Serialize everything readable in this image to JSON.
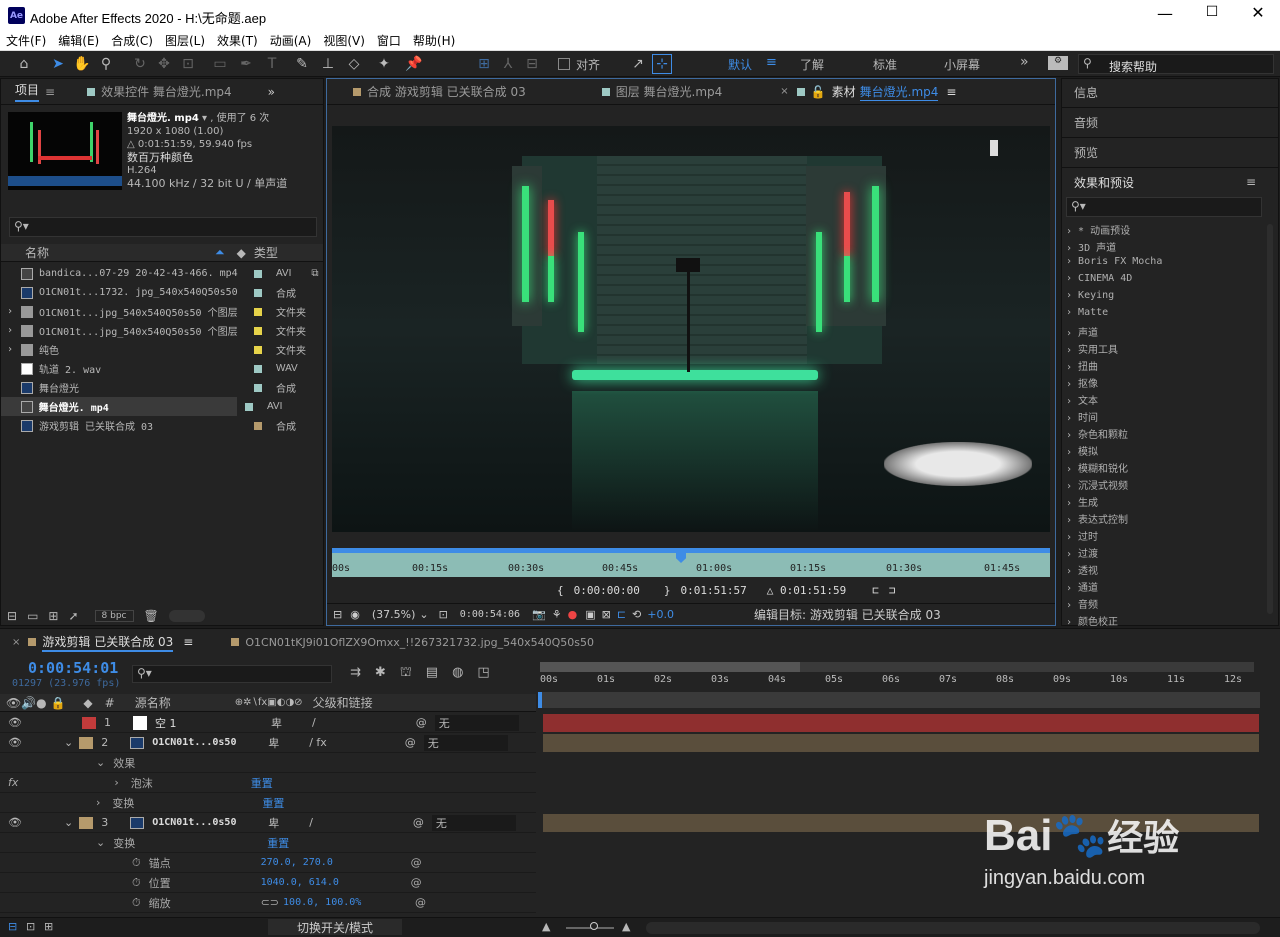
{
  "window": {
    "title": "Adobe After Effects 2020 - H:\\无命题.aep",
    "app_icon": "Ae"
  },
  "menu": [
    "文件(F)",
    "编辑(E)",
    "合成(C)",
    "图层(L)",
    "效果(T)",
    "动画(A)",
    "视图(V)",
    "窗口",
    "帮助(H)"
  ],
  "toolbar": {
    "snap_label": "对齐",
    "workspaces": [
      "默认",
      "了解",
      "标准",
      "小屏幕"
    ],
    "search_placeholder": "搜索帮助"
  },
  "project": {
    "tab_project": "项目",
    "tab_effects": "效果控件 舞台燈光.mp4",
    "asset_name": "舞台燈光. mp4",
    "asset_used": ", 使用了 6 次",
    "asset_res": "1920 x 1080 (1.00)",
    "asset_duration": "△ 0:01:51:59, 59.940 fps",
    "asset_colors": "数百万种颜色",
    "asset_codec": "H.264",
    "asset_audio": "44.100 kHz / 32 bit U / 单声道",
    "col_name": "名称",
    "col_type": "类型",
    "bpc": "8 bpc",
    "items": [
      {
        "name": "bandica...07-29 20-42-43-466. mp4",
        "type": "AVI",
        "color": "#9ec9c4"
      },
      {
        "name": "O1CN01t...1732. jpg_540x540Q50s50",
        "type": "合成",
        "color": "#9ec9c4"
      },
      {
        "name": "O1CN01t...jpg_540x540Q50s50 个图层",
        "type": "文件夹",
        "color": "#e6d34a"
      },
      {
        "name": "O1CN01t...jpg_540x540Q50s50 个图层",
        "type": "文件夹",
        "color": "#e6d34a"
      },
      {
        "name": "纯色",
        "type": "文件夹",
        "color": "#e6d34a"
      },
      {
        "name": "轨道 2. wav",
        "type": "WAV",
        "color": "#9ec9c4"
      },
      {
        "name": "舞台燈光",
        "type": "合成",
        "color": "#9ec9c4"
      },
      {
        "name": "舞台燈光. mp4",
        "type": "AVI",
        "color": "#9ec9c4"
      },
      {
        "name": "游戏剪辑 已关联合成 03",
        "type": "合成",
        "color": "#b59a6c"
      }
    ]
  },
  "viewer": {
    "tab_comp": "合成 游戏剪辑 已关联合成 03",
    "tab_layer": "图层 舞台燈光.mp4",
    "tab_footage_prefix": "素材",
    "tab_footage_name": "舞台燈光.mp4",
    "ruler": [
      "00s",
      "00:15s",
      "00:30s",
      "00:45s",
      "01:00s",
      "01:15s",
      "01:30s",
      "01:45s"
    ],
    "in_time": "0:00:00:00",
    "out_time": "0:01:51:57",
    "duration": "△ 0:01:51:59",
    "zoom": "(37.5%)",
    "current_time": "0:00:54:06",
    "exposure": "+0.0",
    "edit_target": "编辑目标: 游戏剪辑 已关联合成 03"
  },
  "right": {
    "info": "信息",
    "audio": "音频",
    "preview": "预览",
    "effects_title": "效果和预设",
    "effects": [
      "* 动画预设",
      "3D 声道",
      "Boris FX Mocha",
      "CINEMA 4D",
      "Keying",
      "Matte",
      "声道",
      "实用工具",
      "扭曲",
      "抠像",
      "文本",
      "时间",
      "杂色和颗粒",
      "模拟",
      "模糊和锐化",
      "沉浸式视频",
      "生成",
      "表达式控制",
      "过时",
      "过渡",
      "透视",
      "通道",
      "音频",
      "颜色校正"
    ]
  },
  "timeline": {
    "tab_active": "游戏剪辑 已关联合成 03",
    "tab_other": "O1CN01tKJ9i01OflZX9Omxx_!!267321732.jpg_540x540Q50s50",
    "timecode": "0:00:54:01",
    "frames": "01297 (23.976 fps)",
    "col_source": "源名称",
    "col_parent": "父级和链接",
    "ruler": [
      "00s",
      "01s",
      "02s",
      "03s",
      "04s",
      "05s",
      "06s",
      "07s",
      "08s",
      "09s",
      "10s",
      "11s",
      "12s"
    ],
    "layers": [
      {
        "num": "1",
        "name": "空 1",
        "parent": "无",
        "color": "#c23b3b"
      },
      {
        "num": "2",
        "name": "O1CN01t...0s50",
        "parent": "无",
        "color": "#b59a6c"
      },
      {
        "num": "3",
        "name": "O1CN01t...0s50",
        "parent": "无",
        "color": "#b59a6c"
      }
    ],
    "effects_label": "效果",
    "bubble": "泡沫",
    "reset": "重置",
    "transform": "变换",
    "anchor": "锚点",
    "anchor_val": "270.0, 270.0",
    "position": "位置",
    "position_val": "1040.0, 614.0",
    "scale": "缩放",
    "scale_val": "100.0, 100.0%",
    "toggle_label": "切换开关/模式"
  },
  "watermark": {
    "brand": "Bai",
    "brand2": "经验",
    "url": "jingyan.baidu.com"
  }
}
